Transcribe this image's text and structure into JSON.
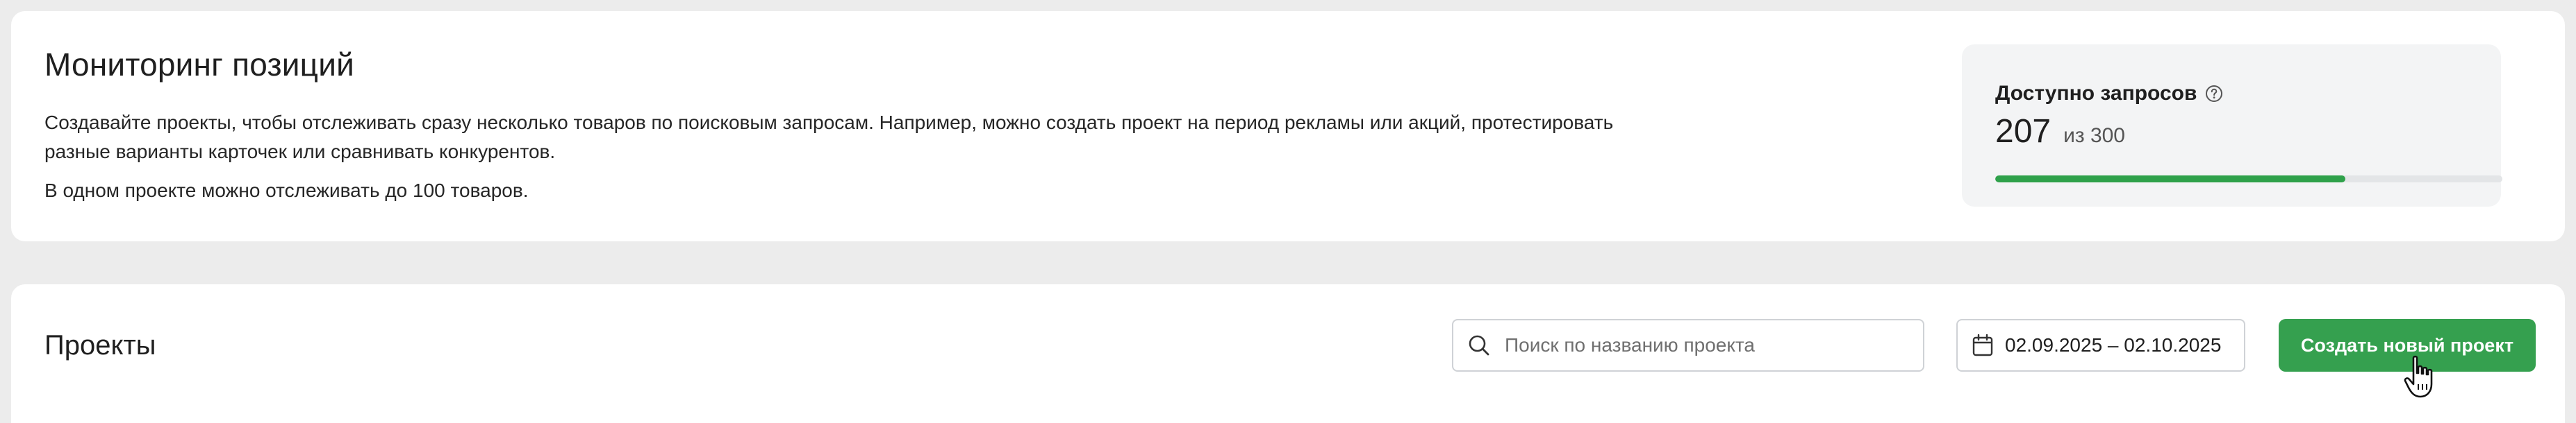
{
  "monitoring": {
    "title": "Мониторинг позиций",
    "description": "Создавайте проекты, чтобы отслеживать сразу несколько товаров по поисковым запросам. Например, можно создать проект на период рекламы или акций, протестировать разные варианты карточек или сравнивать конкурентов.",
    "limit_note": "В одном проекте можно отслеживать до 100 товаров."
  },
  "quota": {
    "label": "Доступно запросов",
    "available": "207",
    "total_text": "из 300",
    "progress_fraction": 0.69,
    "accent_color": "#2ea14a",
    "help_icon": "question-circle-icon"
  },
  "projects": {
    "title": "Проекты",
    "search": {
      "placeholder": "Поиск по названию проекта",
      "value": "",
      "icon": "search-icon"
    },
    "date_range": {
      "value": "02.09.2025 – 02.10.2025",
      "icon": "calendar-icon"
    },
    "create_button": {
      "label": "Создать новый проект",
      "color": "#35a04f"
    }
  }
}
